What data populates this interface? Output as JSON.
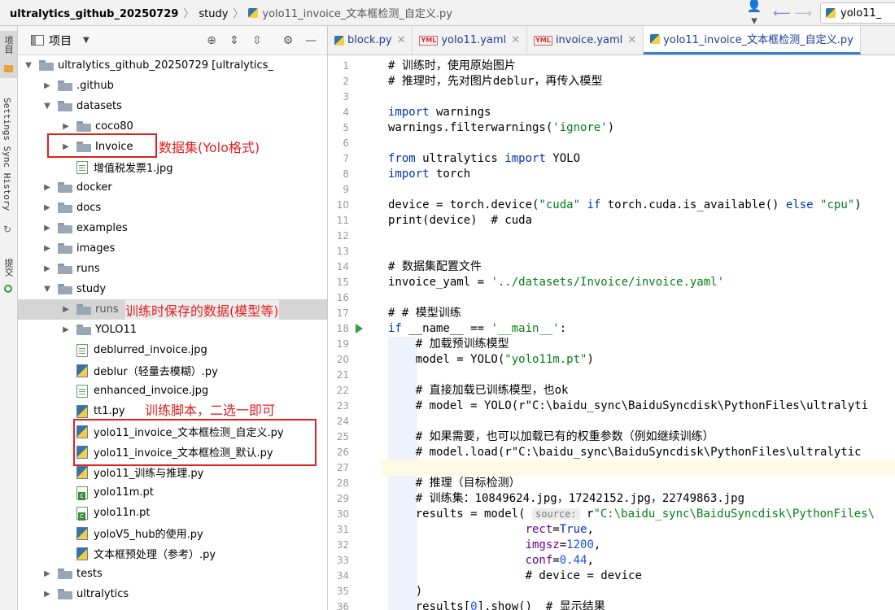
{
  "navbar": {
    "crumb_root": "ultralytics_github_20250729",
    "crumb_folder": "study",
    "crumb_file": "yolo11_invoice_文本框检测_自定义.py",
    "run_config": "yolo11_"
  },
  "stripe": {
    "project_tab": "项目",
    "sync_tab": "Settings Sync History",
    "commit_tab": "提交"
  },
  "project": {
    "title": "项目",
    "rows": [
      {
        "label": "ultralytics_github_20250729 [ultralytics_",
        "kind": "folder",
        "open": true
      },
      {
        "label": ".github",
        "kind": "folder"
      },
      {
        "label": "datasets",
        "kind": "folder",
        "open": true
      },
      {
        "label": "coco80",
        "kind": "folder"
      },
      {
        "label": "Invoice",
        "kind": "folder"
      },
      {
        "label": "增值税发票1.jpg",
        "kind": "jpg"
      },
      {
        "label": "docker",
        "kind": "folder"
      },
      {
        "label": "docs",
        "kind": "folder"
      },
      {
        "label": "examples",
        "kind": "folder"
      },
      {
        "label": "images",
        "kind": "folder"
      },
      {
        "label": "runs",
        "kind": "folder"
      },
      {
        "label": "study",
        "kind": "folder",
        "open": true
      },
      {
        "label": "runs",
        "kind": "folder",
        "selected": true
      },
      {
        "label": "YOLO11",
        "kind": "folder"
      },
      {
        "label": "deblurred_invoice.jpg",
        "kind": "jpg"
      },
      {
        "label": "deblur（轻量去模糊）.py",
        "kind": "py"
      },
      {
        "label": "enhanced_invoice.jpg",
        "kind": "jpg"
      },
      {
        "label": "tt1.py",
        "kind": "py"
      },
      {
        "label": "yolo11_invoice_文本框检测_自定义.py",
        "kind": "py"
      },
      {
        "label": "yolo11_invoice_文本框检测_默认.py",
        "kind": "py"
      },
      {
        "label": "yolo11_训练与推理.py",
        "kind": "py"
      },
      {
        "label": "yolo11m.pt",
        "kind": "pt"
      },
      {
        "label": "yolo11n.pt",
        "kind": "pt"
      },
      {
        "label": "yoloV5_hub的使用.py",
        "kind": "py"
      },
      {
        "label": "文本框预处理（参考）.py",
        "kind": "py"
      },
      {
        "label": "tests",
        "kind": "folder"
      },
      {
        "label": "ultralytics",
        "kind": "folder"
      }
    ]
  },
  "annotations": {
    "dataset": "数据集(Yolo格式)",
    "runs": "训练时保存的数据(模型等)",
    "scripts": "训练脚本，二选一即可"
  },
  "tabs": [
    {
      "label": "block.py",
      "icon": "python-file-icon"
    },
    {
      "label": "yolo11.yaml",
      "icon": "yaml-file-icon"
    },
    {
      "label": "invoice.yaml",
      "icon": "yaml-file-icon"
    },
    {
      "label": "yolo11_invoice_文本框检测_自定义.py",
      "icon": "python-file-icon",
      "active": true
    }
  ],
  "code_lines": [
    "# 训练时，使用原始图片",
    "# 推理时，先对图片deblur，再传入模型",
    "",
    "import warnings",
    "warnings.filterwarnings('ignore')",
    "",
    "from ultralytics import YOLO",
    "import torch",
    "",
    "device = torch.device(\"cuda\" if torch.cuda.is_available() else \"cpu\")",
    "print(device)  # cuda",
    "",
    "",
    "# 数据集配置文件",
    "invoice_yaml = '../datasets/Invoice/invoice.yaml'",
    "",
    "# # 模型训练",
    "if __name__ == '__main__':",
    "    # 加载预训练模型",
    "    model = YOLO(\"yolo11m.pt\")",
    "",
    "    # 直接加载已训练模型，也ok",
    "    # model = YOLO(r\"C:\\baidu_sync\\BaiduSyncdisk\\PythonFiles\\ultralyti",
    "",
    "    # 如果需要，也可以加载已有的权重参数（例如继续训练）",
    "    # model.load(r\"C:\\baidu_sync\\BaiduSyncdisk\\PythonFiles\\ultralytic",
    "",
    "    # 推理（目标检测）",
    "    # 训练集：10849624.jpg，17242152.jpg，22749863.jpg",
    "    results = model( source: r\"C:\\baidu_sync\\BaiduSyncdisk\\PythonFiles\\",
    "                    rect=True,",
    "                    imgsz=1200,",
    "                    conf=0.44,",
    "                    # device = device",
    "    )",
    "    results[0].show()  # 显示结果"
  ],
  "run_line": 18,
  "current_line": 27
}
